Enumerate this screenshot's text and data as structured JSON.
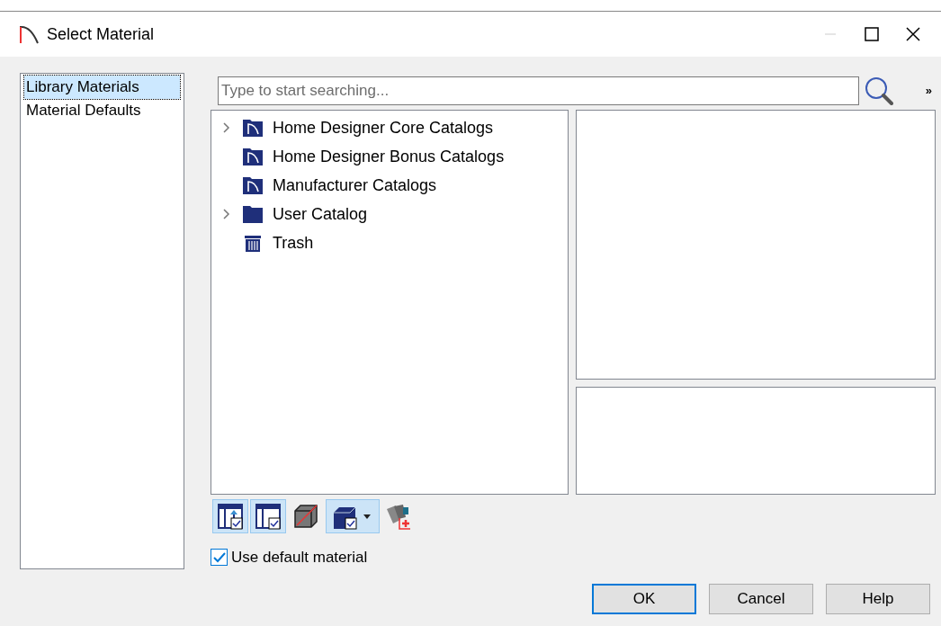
{
  "window": {
    "title": "Select Material",
    "minimize_disabled": true
  },
  "sidebar": {
    "items": [
      {
        "label": "Library Materials",
        "selected": true
      },
      {
        "label": "Material Defaults",
        "selected": false
      }
    ]
  },
  "search": {
    "placeholder": "Type to start searching...",
    "more_glyph": "»"
  },
  "tree": {
    "items": [
      {
        "label": "Home Designer Core Catalogs",
        "kind": "catalog",
        "has_children": true
      },
      {
        "label": "Home Designer Bonus Catalogs",
        "kind": "catalog",
        "has_children": false
      },
      {
        "label": "Manufacturer Catalogs",
        "kind": "catalog",
        "has_children": false
      },
      {
        "label": "User Catalog",
        "kind": "folder",
        "has_children": true
      },
      {
        "label": "Trash",
        "kind": "trash",
        "has_children": false
      }
    ]
  },
  "toolbar": {
    "tools": [
      {
        "kind": "column-up",
        "pressed": true
      },
      {
        "kind": "column",
        "pressed": true
      },
      {
        "kind": "no-material",
        "pressed": false
      },
      {
        "kind": "cube-dropdown",
        "pressed": true
      },
      {
        "kind": "add-swatch",
        "pressed": false
      }
    ]
  },
  "use_default_material": {
    "label": "Use default material",
    "checked": true
  },
  "buttons": [
    {
      "label": "OK",
      "default": true
    },
    {
      "label": "Cancel",
      "default": false
    },
    {
      "label": "Help",
      "default": false
    }
  ]
}
